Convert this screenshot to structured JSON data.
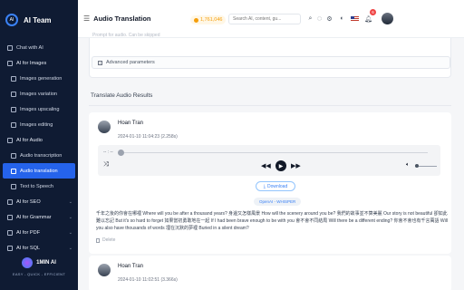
{
  "brand": {
    "name": "AI Team"
  },
  "sidebar": {
    "items": [
      {
        "label": "Chat with AI",
        "kind": "top"
      },
      {
        "label": "AI for Images",
        "kind": "section"
      },
      {
        "label": "Images generation",
        "kind": "sub"
      },
      {
        "label": "Images variation",
        "kind": "sub"
      },
      {
        "label": "Images upscaling",
        "kind": "sub"
      },
      {
        "label": "Images editing",
        "kind": "sub"
      },
      {
        "label": "AI for Audio",
        "kind": "section"
      },
      {
        "label": "Audio transcription",
        "kind": "sub"
      },
      {
        "label": "Audio translation",
        "kind": "sub-active"
      },
      {
        "label": "Text to Speech",
        "kind": "sub"
      },
      {
        "label": "AI for SEO",
        "kind": "section-collapsed"
      },
      {
        "label": "AI for Grammar",
        "kind": "section-collapsed"
      },
      {
        "label": "AI for PDF",
        "kind": "section-collapsed"
      },
      {
        "label": "AI for SQL",
        "kind": "section-collapsed"
      }
    ],
    "footer": {
      "logo_text": "1MIN AI",
      "tagline": "EASY - QUICK - EFFICIENT"
    }
  },
  "header": {
    "title": "Audio Translation",
    "credits": "1,761,046",
    "search_placeholder": "Search AI, content, gu...",
    "notification_count": "6"
  },
  "form": {
    "prompt_placeholder": "Prompt for audio. Can be skipped",
    "advanced_label": "Advanced parameters"
  },
  "results": {
    "title": "Translate Audio Results",
    "items": [
      {
        "user": "Hoan Tran",
        "datetime": "2024-01-10 11:04:23 (2.258s)",
        "player_time": "-- : --",
        "download_label": "Download",
        "model": "OpenAI - WHISPER",
        "transcript": "千年之後的你會在哪裡 Where will you be after a thousand years? 身邊又怎樣風景 How will the scenery around you be? 我們的故事並不算美麗 Our story is not beautiful 卻如此難以忘記 But it's so hard to forget 如果當初勇敢地在一起 If I had been brave enough to be with you 會不會不同結局 Will there be a different ending? 你會不會也有千言萬語 Will you also have thousands of words 埋在沉默的夢裡 Buried in a silent dream?",
        "delete_label": "Delete"
      },
      {
        "user": "Hoan Tran",
        "datetime": "2024-01-10 11:02:51 (3.366s)"
      }
    ]
  }
}
